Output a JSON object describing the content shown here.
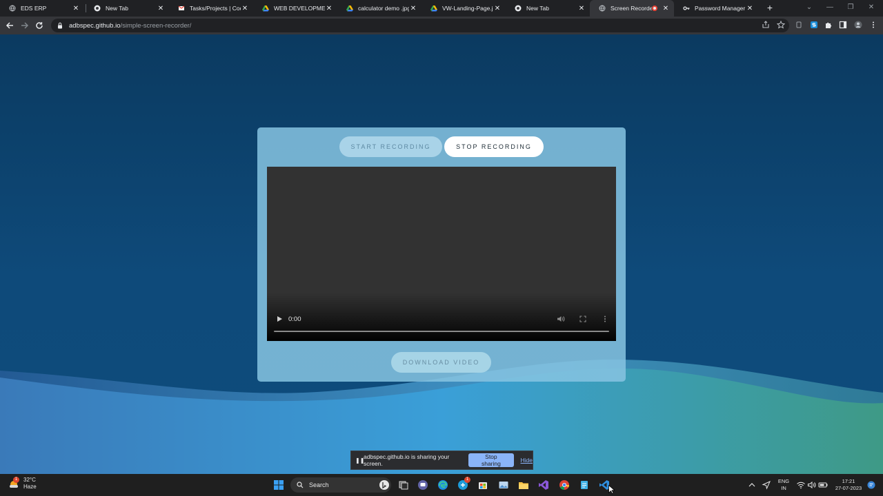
{
  "browser": {
    "tabs": [
      {
        "label": "EDS ERP",
        "icon": "globe-icon",
        "active": false
      },
      {
        "label": "New Tab",
        "icon": "chrome-icon",
        "active": false
      },
      {
        "label": "Tasks/Projects | CodSo",
        "icon": "gmail-icon",
        "active": false
      },
      {
        "label": "WEB DEVELOPMENT I",
        "icon": "drive-icon",
        "active": false
      },
      {
        "label": "calculator demo .jpg",
        "icon": "drive-icon",
        "active": false
      },
      {
        "label": "VW-Landing-Page.jpg",
        "icon": "drive-icon",
        "active": false
      },
      {
        "label": "New Tab",
        "icon": "chrome-icon",
        "active": false
      },
      {
        "label": "Screen Recorder",
        "icon": "globe-icon",
        "active": true
      },
      {
        "label": "Password Manager",
        "icon": "key-icon",
        "active": false
      }
    ],
    "url_host": "adbspec.github.io",
    "url_path": "/simple-screen-recorder/"
  },
  "recorder": {
    "start_label": "START RECORDING",
    "stop_label": "STOP RECORDING",
    "download_label": "DOWNLOAD VIDEO",
    "video_time": "0:00"
  },
  "share_bar": {
    "message": "adbspec.github.io is sharing your screen.",
    "stop_label": "Stop sharing",
    "hide_label": "Hide"
  },
  "taskbar": {
    "weather_temp": "32°C",
    "weather_desc": "Haze",
    "weather_badge": "1",
    "search_label": "Search",
    "teams_badge": "1",
    "lang_line1": "ENG",
    "lang_line2": "IN",
    "time": "17:21",
    "date": "27-07-2023",
    "colors": {
      "accent": "#8ab4f8",
      "record": "#ea4335"
    }
  }
}
